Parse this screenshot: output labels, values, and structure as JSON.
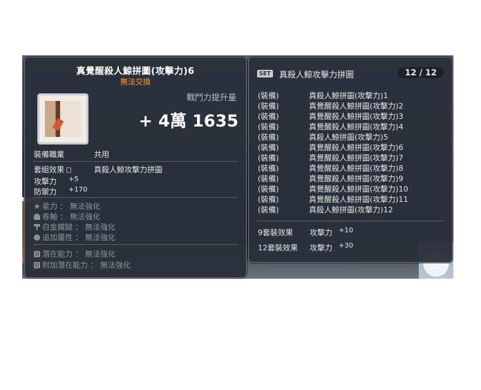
{
  "item": {
    "name": "真覺醒殺人鯨拼圖(攻擊力)6",
    "trade_status": "無法交換",
    "combat_power_label": "戰鬥力提升量",
    "combat_power_value": "+ 4萬 1635",
    "job_label": "裝備職業",
    "job_value": "共用",
    "set_effect_label": "套組效果",
    "set_effect_value": "真殺人鯨攻擊力拼圖",
    "stats": [
      {
        "label": "攻擊力",
        "value": "+5"
      },
      {
        "label": "防禦力",
        "value": "+170"
      }
    ],
    "enhancements": [
      {
        "icon": "star-icon",
        "label": "星力",
        "value": "無法強化"
      },
      {
        "icon": "scroll-icon",
        "label": "卷軸",
        "value": "無法強化"
      },
      {
        "icon": "hammer-icon",
        "label": "白金鐵鎚",
        "value": "無法強化"
      },
      {
        "icon": "bonus-stat-icon",
        "label": "追加屬性",
        "value": "無法強化"
      }
    ],
    "potentials": [
      {
        "icon": "potential-icon",
        "label": "潛在能力",
        "value": "無法強化"
      },
      {
        "icon": "additional-potential-icon",
        "label": "附加潛在能力",
        "value": "無法強化"
      }
    ]
  },
  "set": {
    "badge": "SET",
    "name": "真殺人鯨攻擊力拼圖",
    "count": "12 / 12",
    "pieces": [
      {
        "tag": "(裝備)",
        "name": "真殺人鯨拼圖(攻擊力)1"
      },
      {
        "tag": "(裝備)",
        "name": "真覺醒殺人鯨拼圖(攻擊力)2"
      },
      {
        "tag": "(裝備)",
        "name": "真覺醒殺人鯨拼圖(攻擊力)3"
      },
      {
        "tag": "(裝備)",
        "name": "真覺醒殺人鯨拼圖(攻擊力)4"
      },
      {
        "tag": "(裝備)",
        "name": "真殺人鯨拼圖(攻擊力)5"
      },
      {
        "tag": "(裝備)",
        "name": "真覺醒殺人鯨拼圖(攻擊力)6"
      },
      {
        "tag": "(裝備)",
        "name": "真覺醒殺人鯨拼圖(攻擊力)7"
      },
      {
        "tag": "(裝備)",
        "name": "真覺醒殺人鯨拼圖(攻擊力)8"
      },
      {
        "tag": "(裝備)",
        "name": "真覺醒殺人鯨拼圖(攻擊力)9"
      },
      {
        "tag": "(裝備)",
        "name": "真覺醒殺人鯨拼圖(攻擊力)10"
      },
      {
        "tag": "(裝備)",
        "name": "真覺醒殺人鯨拼圖(攻擊力)11"
      },
      {
        "tag": "(裝備)",
        "name": "真殺人鯨拼圖(攻擊力)12"
      }
    ],
    "effects": [
      {
        "label": "9套裝效果",
        "stat": "攻擊力",
        "value": "+10"
      },
      {
        "label": "12套裝效果",
        "stat": "攻擊力",
        "value": "+30"
      }
    ]
  }
}
